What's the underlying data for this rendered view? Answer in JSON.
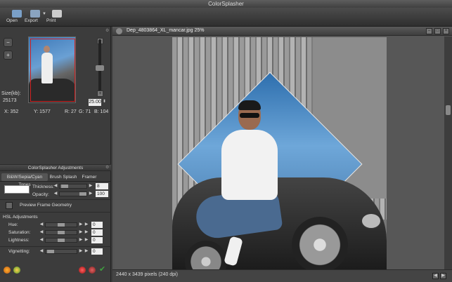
{
  "window": {
    "title": "ColorSplasher"
  },
  "toolbar": {
    "items": [
      {
        "label": "Open",
        "icon": "open-icon"
      },
      {
        "label": "Export",
        "icon": "export-icon"
      },
      {
        "label": "Print",
        "icon": "print-icon"
      }
    ]
  },
  "navigator": {
    "size_label": "Size(kb):",
    "size_value": "25173",
    "zoom_value": "25.00",
    "x": "X: 352",
    "y": "Y: 1577",
    "r": "R: 27",
    "g": "G: 71",
    "b": "B: 104"
  },
  "adjustments": {
    "title": "ColorSplasher Adjustments",
    "tabs": [
      "B&W/Sepia/Cyan Tones",
      "Brush Splash",
      "Framer"
    ],
    "selected_tab": "B&W/Sepia/Cyan Tones",
    "thickness_label": "Thickness:",
    "thickness_value": "8",
    "opacity_label": "Opacity:",
    "opacity_value": "100",
    "preview_label": "Preview Frame Geometry",
    "hsl_title": "HSL Adjustments",
    "hue_label": "Hue:",
    "hue_value": "0",
    "saturation_label": "Saturation:",
    "saturation_value": "0",
    "lightness_label": "Lightness:",
    "lightness_value": "0",
    "vignetting_label": "Vignetting:",
    "vignetting_value": "0"
  },
  "document": {
    "title": "Dep_4803864_XL_mancar.jpg 25%",
    "status": "2440 x 3439 pixels (240 dpi)"
  },
  "colors": {
    "accent_green": "#3fa03f",
    "frame_red": "#d02020",
    "sky_blue": "#3d76b3"
  }
}
